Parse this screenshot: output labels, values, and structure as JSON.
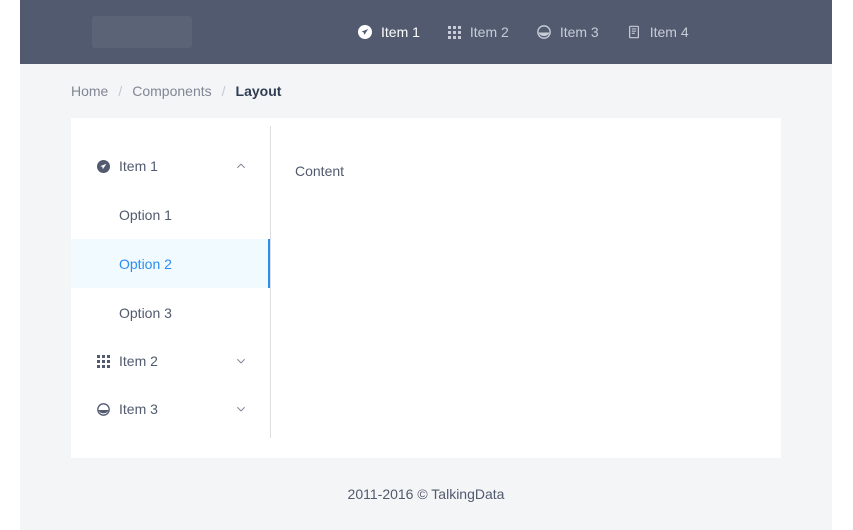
{
  "navbar": {
    "logo_name": "logo-placeholder",
    "items": [
      {
        "label": "Item 1",
        "icon": "navigation-arrow-icon",
        "active": true
      },
      {
        "label": "Item 2",
        "icon": "grid-icon",
        "active": false
      },
      {
        "label": "Item 3",
        "icon": "contrast-circle-icon",
        "active": false
      },
      {
        "label": "Item 4",
        "icon": "document-icon",
        "active": false
      }
    ]
  },
  "breadcrumb": {
    "home": "Home",
    "components": "Components",
    "current": "Layout",
    "separator": "/"
  },
  "sidebar": {
    "groups": [
      {
        "label": "Item 1",
        "icon": "navigation-arrow-icon",
        "chevron": "chevron-up-icon",
        "expanded": true,
        "options": [
          {
            "label": "Option 1",
            "selected": false
          },
          {
            "label": "Option 2",
            "selected": true
          },
          {
            "label": "Option 3",
            "selected": false
          }
        ]
      },
      {
        "label": "Item 2",
        "icon": "grid-icon",
        "chevron": "chevron-down-icon",
        "expanded": false,
        "options": []
      },
      {
        "label": "Item 3",
        "icon": "contrast-circle-icon",
        "chevron": "chevron-down-icon",
        "expanded": false,
        "options": []
      }
    ]
  },
  "main": {
    "content_text": "Content"
  },
  "footer": {
    "text": "2011-2016 © TalkingData"
  },
  "colors": {
    "navbar_bg": "#515a6e",
    "page_bg": "#f4f5f7",
    "card_bg": "#ffffff",
    "accent": "#2d8cf0",
    "selected_bg": "#f0faff",
    "text": "#515a6e",
    "muted_text": "#808695"
  }
}
